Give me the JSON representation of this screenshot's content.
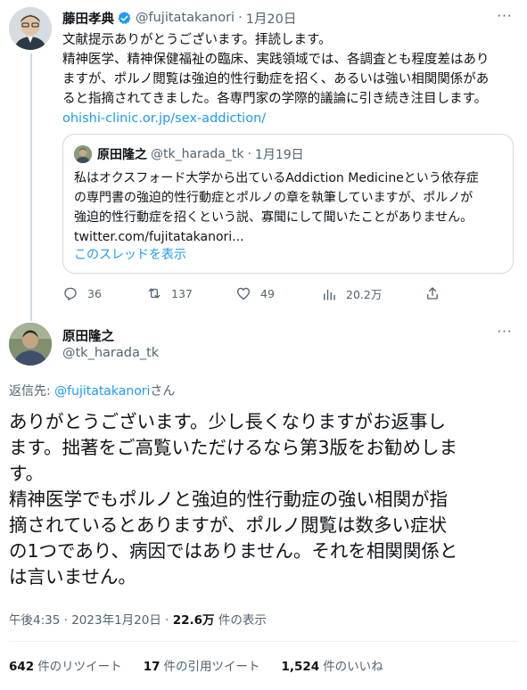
{
  "parent_tweet": {
    "author_name": "藤田孝典",
    "author_handle": "@fujitatakanori",
    "separator": "·",
    "date": "1月20日",
    "more_label": "···",
    "text_lines": [
      "文献提示ありがとうございます。拝読します。",
      "精神医学、精神保健福祉の臨床、実践領域では、各調査とも程度差はあり",
      "ますが、ポルノ閲覧は強迫的性行動症を招く、あるいは強い相関関係があ",
      "ると指摘されてきました。各専門家の学際的議論に引き続き注目します。"
    ],
    "link": "ohishi-clinic.or.jp/sex-addiction/",
    "quote": {
      "author_name": "原田隆之",
      "author_handle": "@tk_harada_tk",
      "separator": "·",
      "date": "1月19日",
      "text_lines": [
        "私はオクスフォード大学から出ているAddiction Medicineという依存症",
        "の専門書の強迫的性行動症とポルノの章を執筆していますが、ポルノが",
        "強迫的性行動症を招くという説、寡聞にして聞いたことがありません。",
        "twitter.com/fujitatakanori..."
      ],
      "show_thread": "このスレッドを表示"
    },
    "actions": {
      "replies": "36",
      "retweets": "137",
      "likes": "49",
      "views": "20.2万"
    }
  },
  "reply_tweet": {
    "author_name": "原田隆之",
    "author_handle": "@tk_harada_tk",
    "more_label": "···",
    "replying_prefix": "返信先: ",
    "replying_mention": "@fujitatakanori",
    "replying_suffix": "さん",
    "text_lines": [
      "ありがとうございます。少し長くなりますがお返事し",
      "ます。拙著をご高覧いただけるなら第3版をお勧めしま",
      "す。",
      "精神医学でもポルノと強迫的性行動症の強い相関が指",
      "摘されているとありますが、ポルノ閲覧は数多い症状",
      "の1つであり、病因ではありません。それを相関関係と",
      "は言いません。"
    ],
    "time": "午後4:35",
    "separator": "·",
    "date": "2023年1月20日",
    "views_count": "22.6万",
    "views_label": "件の表示",
    "stats": {
      "retweets_count": "642",
      "retweets_label": "件のリツイート",
      "quotes_count": "17",
      "quotes_label": "件の引用ツイート",
      "likes_count": "1,524",
      "likes_label": "件のいいね"
    }
  },
  "colors": {
    "link": "#1d9bf0",
    "secondary_text": "#536471",
    "border": "#cfd9de",
    "verified_badge": "#1d9bf0"
  }
}
